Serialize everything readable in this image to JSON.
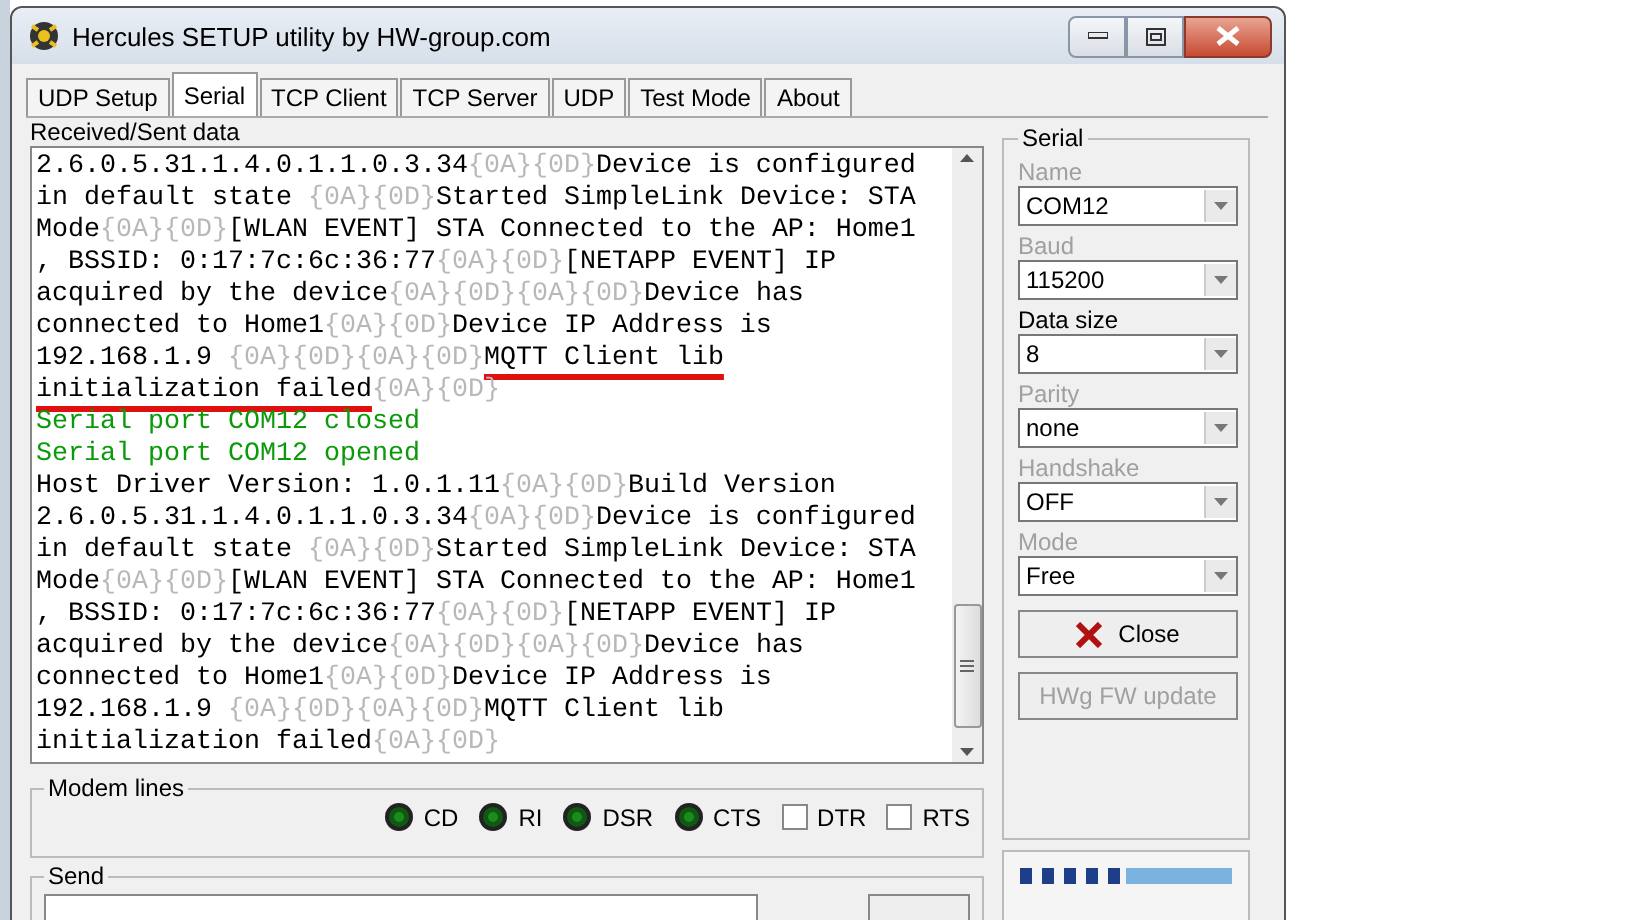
{
  "window": {
    "title": "Hercules SETUP utility by HW-group.com"
  },
  "tabs": [
    {
      "label": "UDP Setup",
      "selected": false
    },
    {
      "label": "Serial",
      "selected": true
    },
    {
      "label": "TCP Client",
      "selected": false
    },
    {
      "label": "TCP Server",
      "selected": false
    },
    {
      "label": "UDP",
      "selected": false
    },
    {
      "label": "Test Mode",
      "selected": false
    },
    {
      "label": "About",
      "selected": false
    }
  ],
  "log": {
    "label": "Received/Sent data",
    "lines": [
      [
        {
          "kind": "text",
          "text": "2.6.0.5.31.1.4.0.1.1.0.3.34",
          "marked": false
        },
        {
          "kind": "code",
          "text": "{0A}{0D}",
          "marked": false
        },
        {
          "kind": "text",
          "text": "Device is configured",
          "marked": false
        }
      ],
      [
        {
          "kind": "text",
          "text": "in default state ",
          "marked": false
        },
        {
          "kind": "code",
          "text": "{0A}{0D}",
          "marked": false
        },
        {
          "kind": "text",
          "text": "Started SimpleLink Device: STA",
          "marked": false
        }
      ],
      [
        {
          "kind": "text",
          "text": "Mode",
          "marked": false
        },
        {
          "kind": "code",
          "text": "{0A}{0D}",
          "marked": false
        },
        {
          "kind": "text",
          "text": "[WLAN EVENT] STA Connected to the AP: Home1",
          "marked": false
        }
      ],
      [
        {
          "kind": "text",
          "text": ", BSSID: 0:17:7c:6c:36:77",
          "marked": false
        },
        {
          "kind": "code",
          "text": "{0A}{0D}",
          "marked": false
        },
        {
          "kind": "text",
          "text": "[NETAPP EVENT] IP",
          "marked": false
        }
      ],
      [
        {
          "kind": "text",
          "text": "acquired by the device",
          "marked": false
        },
        {
          "kind": "code",
          "text": "{0A}{0D}{0A}{0D}",
          "marked": false
        },
        {
          "kind": "text",
          "text": "Device has",
          "marked": false
        }
      ],
      [
        {
          "kind": "text",
          "text": "connected to Home1",
          "marked": false
        },
        {
          "kind": "code",
          "text": "{0A}{0D}",
          "marked": false
        },
        {
          "kind": "text",
          "text": "Device IP Address is",
          "marked": false
        }
      ],
      [
        {
          "kind": "text",
          "text": "192.168.1.9 ",
          "marked": false
        },
        {
          "kind": "code",
          "text": "{0A}{0D}{0A}{0D}",
          "marked": false
        },
        {
          "kind": "text",
          "text": "MQTT Client lib",
          "marked": true
        }
      ],
      [
        {
          "kind": "text",
          "text": "initialization failed",
          "marked": true
        },
        {
          "kind": "code",
          "text": "{0A}{0D}",
          "marked": false
        }
      ],
      [
        {
          "kind": "status",
          "text": "Serial port COM12 closed",
          "marked": false
        }
      ],
      [
        {
          "kind": "status",
          "text": "Serial port COM12 opened",
          "marked": false
        }
      ],
      [
        {
          "kind": "text",
          "text": "Host Driver Version: 1.0.1.11",
          "marked": false
        },
        {
          "kind": "code",
          "text": "{0A}{0D}",
          "marked": false
        },
        {
          "kind": "text",
          "text": "Build Version",
          "marked": false
        }
      ],
      [
        {
          "kind": "text",
          "text": "2.6.0.5.31.1.4.0.1.1.0.3.34",
          "marked": false
        },
        {
          "kind": "code",
          "text": "{0A}{0D}",
          "marked": false
        },
        {
          "kind": "text",
          "text": "Device is configured",
          "marked": false
        }
      ],
      [
        {
          "kind": "text",
          "text": "in default state ",
          "marked": false
        },
        {
          "kind": "code",
          "text": "{0A}{0D}",
          "marked": false
        },
        {
          "kind": "text",
          "text": "Started SimpleLink Device: STA",
          "marked": false
        }
      ],
      [
        {
          "kind": "text",
          "text": "Mode",
          "marked": false
        },
        {
          "kind": "code",
          "text": "{0A}{0D}",
          "marked": false
        },
        {
          "kind": "text",
          "text": "[WLAN EVENT] STA Connected to the AP: Home1",
          "marked": false
        }
      ],
      [
        {
          "kind": "text",
          "text": ", BSSID: 0:17:7c:6c:36:77",
          "marked": false
        },
        {
          "kind": "code",
          "text": "{0A}{0D}",
          "marked": false
        },
        {
          "kind": "text",
          "text": "[NETAPP EVENT] IP",
          "marked": false
        }
      ],
      [
        {
          "kind": "text",
          "text": "acquired by the device",
          "marked": false
        },
        {
          "kind": "code",
          "text": "{0A}{0D}{0A}{0D}",
          "marked": false
        },
        {
          "kind": "text",
          "text": "Device has",
          "marked": false
        }
      ],
      [
        {
          "kind": "text",
          "text": "connected to Home1",
          "marked": false
        },
        {
          "kind": "code",
          "text": "{0A}{0D}",
          "marked": false
        },
        {
          "kind": "text",
          "text": "Device IP Address is",
          "marked": false
        }
      ],
      [
        {
          "kind": "text",
          "text": "192.168.1.9 ",
          "marked": false
        },
        {
          "kind": "code",
          "text": "{0A}{0D}{0A}{0D}",
          "marked": false
        },
        {
          "kind": "text",
          "text": "MQTT Client lib",
          "marked": false
        }
      ],
      [
        {
          "kind": "text",
          "text": "initialization failed",
          "marked": false
        },
        {
          "kind": "code",
          "text": "{0A}{0D}",
          "marked": false
        }
      ]
    ]
  },
  "modem_lines": {
    "label": "Modem lines",
    "leds": [
      {
        "label": "CD",
        "on": false
      },
      {
        "label": "RI",
        "on": false
      },
      {
        "label": "DSR",
        "on": false
      },
      {
        "label": "CTS",
        "on": false
      }
    ],
    "checkboxes": [
      {
        "label": "DTR",
        "checked": false
      },
      {
        "label": "RTS",
        "checked": false
      }
    ]
  },
  "send": {
    "label": "Send"
  },
  "serial": {
    "label": "Serial",
    "fields": [
      {
        "label": "Name",
        "value": "COM12",
        "disabled": true
      },
      {
        "label": "Baud",
        "value": "115200",
        "disabled": true
      },
      {
        "label": "Data size",
        "value": "8",
        "disabled": false
      },
      {
        "label": "Parity",
        "value": "none",
        "disabled": true
      },
      {
        "label": "Handshake",
        "value": "OFF",
        "disabled": true
      },
      {
        "label": "Mode",
        "value": "Free",
        "disabled": true
      }
    ],
    "buttons": [
      {
        "label": "Close",
        "disabled": false
      },
      {
        "label": "HWg FW update",
        "disabled": true
      }
    ]
  }
}
